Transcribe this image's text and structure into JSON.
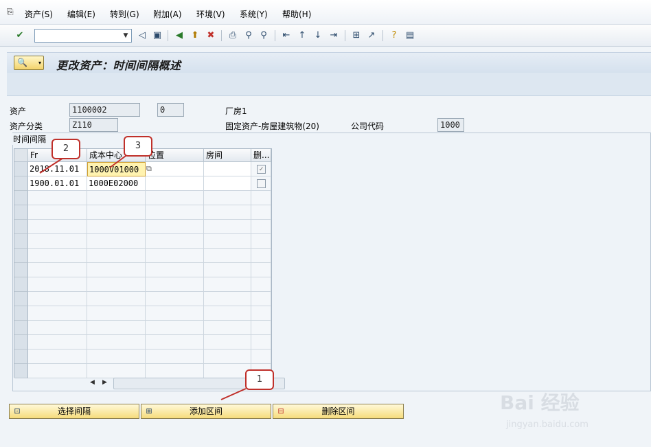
{
  "menu": [
    "资产(S)",
    "编辑(E)",
    "转到(G)",
    "附加(A)",
    "环境(V)",
    "系统(Y)",
    "帮助(H)"
  ],
  "toolbar": {
    "command_value": "",
    "icons": [
      "check-icon",
      "back-icon",
      "save-icon",
      "nav-back-icon",
      "exit-icon",
      "cancel-icon",
      "print-icon",
      "find-icon",
      "find-next-icon",
      "first-page-icon",
      "prev-page-icon",
      "next-page-icon",
      "last-page-icon",
      "new-session-icon",
      "shortcut-icon",
      "help-icon",
      "layout-icon"
    ]
  },
  "title": "更改资产：时间间隔概述",
  "header": {
    "asset_label": "资产",
    "asset_number": "1100002",
    "asset_sub": "0",
    "asset_desc": "厂房1",
    "class_label": "资产分类",
    "class_value": "Z110",
    "class_desc": "固定资产-房屋建筑物(20)",
    "company_label": "公司代码",
    "company_value": "1000"
  },
  "group_title": "时间间隔",
  "table": {
    "columns": [
      "Fr",
      "成本中心",
      "位置",
      "房间",
      "删..."
    ],
    "rows": [
      {
        "from": "2018.11.01",
        "cost_center": "1000V01000",
        "location": "",
        "room": "",
        "delete": "✓"
      },
      {
        "from": "1900.01.01",
        "cost_center": "1000E02000",
        "location": "",
        "room": "",
        "delete": ""
      }
    ]
  },
  "buttons": {
    "select": "选择间隔",
    "add": "添加区间",
    "delete": "删除区间"
  },
  "callouts": [
    "1",
    "2",
    "3"
  ],
  "watermark": {
    "brand": "Bai 经验",
    "url": "jingyan.baidu.com"
  },
  "colors": {
    "accent": "#c0302a",
    "button": "#f6dc7c",
    "active_cell": "#fff3b0"
  }
}
